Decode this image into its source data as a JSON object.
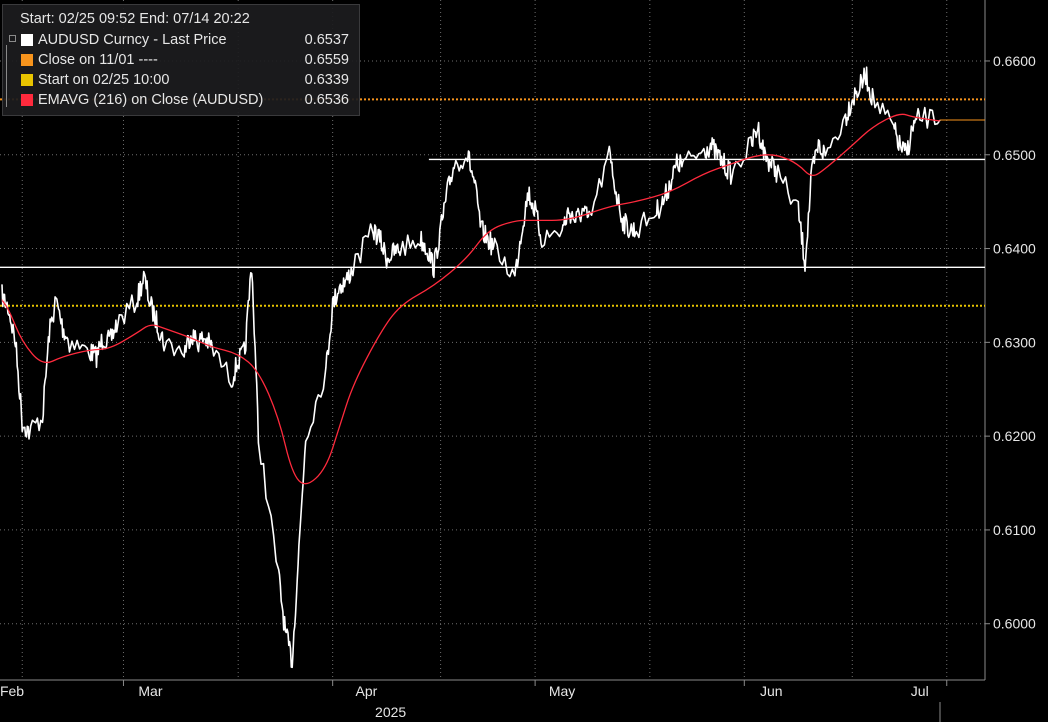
{
  "legend": {
    "header": "Start: 02/25 09:52 End: 07/14 20:22",
    "items": [
      {
        "label": "AUDUSD Curncy - Last Price",
        "value": "0.6537",
        "color": "#ffffff"
      },
      {
        "label": "Close on 11/01 ----",
        "value": "0.6559",
        "color": "#f7941d"
      },
      {
        "label": "Start on 02/25 10:00",
        "value": "0.6339",
        "color": "#e8c400"
      },
      {
        "label": "EMAVG (216)  on Close (AUDUSD)",
        "value": "0.6536",
        "color": "#ff2a3d"
      }
    ]
  },
  "chart_data": {
    "type": "line",
    "x_labels": [
      "Feb",
      "Mar",
      "Apr",
      "May",
      "Jun",
      "Jul"
    ],
    "year_label": "2025",
    "y_ticks": [
      "0.6000",
      "0.6100",
      "0.6200",
      "0.6300",
      "0.6400",
      "0.6500",
      "0.6600"
    ],
    "ylim": [
      0.594,
      0.6665
    ],
    "series": [
      {
        "name": "AUDUSD Curncy - Last Price",
        "color": "#ffffff",
        "points": [
          [
            "02-25",
            0.635
          ],
          [
            "02-26",
            0.6335
          ],
          [
            "02-27",
            0.63
          ],
          [
            "02-28",
            0.6215
          ],
          [
            "03-01",
            0.6205
          ],
          [
            "03-03",
            0.622
          ],
          [
            "03-04",
            0.631
          ],
          [
            "03-05",
            0.6345
          ],
          [
            "03-06",
            0.6315
          ],
          [
            "03-07",
            0.63
          ],
          [
            "03-10",
            0.629
          ],
          [
            "03-11",
            0.6285
          ],
          [
            "03-12",
            0.6305
          ],
          [
            "03-13",
            0.63
          ],
          [
            "03-14",
            0.632
          ],
          [
            "03-17",
            0.6345
          ],
          [
            "03-18",
            0.637
          ],
          [
            "03-19",
            0.634
          ],
          [
            "03-20",
            0.632
          ],
          [
            "03-21",
            0.63
          ],
          [
            "03-24",
            0.629
          ],
          [
            "03-25",
            0.631
          ],
          [
            "03-26",
            0.63
          ],
          [
            "03-27",
            0.6305
          ],
          [
            "03-28",
            0.6295
          ],
          [
            "03-31",
            0.626
          ],
          [
            "04-01",
            0.628
          ],
          [
            "04-02",
            0.629
          ],
          [
            "04-03",
            0.6385
          ],
          [
            "04-04",
            0.62
          ],
          [
            "04-07",
            0.605
          ],
          [
            "04-08",
            0.599
          ],
          [
            "04-09",
            0.596
          ],
          [
            "04-10",
            0.608
          ],
          [
            "04-11",
            0.62
          ],
          [
            "04-14",
            0.627
          ],
          [
            "04-15",
            0.634
          ],
          [
            "04-16",
            0.636
          ],
          [
            "04-17",
            0.6365
          ],
          [
            "04-18",
            0.638
          ],
          [
            "04-21",
            0.642
          ],
          [
            "04-22",
            0.641
          ],
          [
            "04-23",
            0.639
          ],
          [
            "04-24",
            0.6395
          ],
          [
            "04-25",
            0.64
          ],
          [
            "04-28",
            0.641
          ],
          [
            "04-29",
            0.64
          ],
          [
            "04-30",
            0.638
          ],
          [
            "05-01",
            0.642
          ],
          [
            "05-02",
            0.646
          ],
          [
            "05-03",
            0.649
          ],
          [
            "05-05",
            0.65
          ],
          [
            "05-06",
            0.647
          ],
          [
            "05-07",
            0.642
          ],
          [
            "05-08",
            0.641
          ],
          [
            "05-09",
            0.64
          ],
          [
            "05-12",
            0.637
          ],
          [
            "05-13",
            0.642
          ],
          [
            "05-14",
            0.646
          ],
          [
            "05-15",
            0.644
          ],
          [
            "05-16",
            0.641
          ],
          [
            "05-19",
            0.642
          ],
          [
            "05-20",
            0.644
          ],
          [
            "05-21",
            0.643
          ],
          [
            "05-22",
            0.644
          ],
          [
            "05-23",
            0.643
          ],
          [
            "05-26",
            0.65
          ],
          [
            "05-27",
            0.646
          ],
          [
            "05-28",
            0.643
          ],
          [
            "05-29",
            0.642
          ],
          [
            "05-30",
            0.642
          ],
          [
            "06-02",
            0.644
          ],
          [
            "06-03",
            0.645
          ],
          [
            "06-04",
            0.647
          ],
          [
            "06-05",
            0.649
          ],
          [
            "06-06",
            0.649
          ],
          [
            "06-09",
            0.6505
          ],
          [
            "06-10",
            0.651
          ],
          [
            "06-11",
            0.65
          ],
          [
            "06-12",
            0.649
          ],
          [
            "06-13",
            0.648
          ],
          [
            "06-16",
            0.651
          ],
          [
            "06-17",
            0.653
          ],
          [
            "06-18",
            0.65
          ],
          [
            "06-19",
            0.649
          ],
          [
            "06-20",
            0.648
          ],
          [
            "06-23",
            0.644
          ],
          [
            "06-24",
            0.6385
          ],
          [
            "06-25",
            0.648
          ],
          [
            "06-26",
            0.651
          ],
          [
            "06-27",
            0.65
          ],
          [
            "06-30",
            0.654
          ],
          [
            "07-01",
            0.656
          ],
          [
            "07-02",
            0.657
          ],
          [
            "07-03",
            0.6585
          ],
          [
            "07-04",
            0.656
          ],
          [
            "07-07",
            0.653
          ],
          [
            "07-08",
            0.651
          ],
          [
            "07-09",
            0.65
          ],
          [
            "07-10",
            0.653
          ],
          [
            "07-11",
            0.654
          ],
          [
            "07-14",
            0.6537
          ]
        ]
      },
      {
        "name": "EMAVG (216)  on Close (AUDUSD)",
        "color": "#ff2a3d",
        "points": [
          [
            "02-25",
            0.6345
          ],
          [
            "02-26",
            0.6335
          ],
          [
            "02-28",
            0.63
          ],
          [
            "03-03",
            0.6275
          ],
          [
            "03-06",
            0.6285
          ],
          [
            "03-10",
            0.6292
          ],
          [
            "03-13",
            0.6293
          ],
          [
            "03-17",
            0.631
          ],
          [
            "03-19",
            0.632
          ],
          [
            "03-21",
            0.6315
          ],
          [
            "03-25",
            0.6305
          ],
          [
            "03-28",
            0.6295
          ],
          [
            "04-01",
            0.6288
          ],
          [
            "04-04",
            0.627
          ],
          [
            "04-07",
            0.622
          ],
          [
            "04-09",
            0.616
          ],
          [
            "04-11",
            0.6145
          ],
          [
            "04-14",
            0.6165
          ],
          [
            "04-16",
            0.621
          ],
          [
            "04-18",
            0.6255
          ],
          [
            "04-22",
            0.631
          ],
          [
            "04-25",
            0.634
          ],
          [
            "04-30",
            0.636
          ],
          [
            "05-05",
            0.639
          ],
          [
            "05-08",
            0.642
          ],
          [
            "05-12",
            0.643
          ],
          [
            "05-15",
            0.643
          ],
          [
            "05-20",
            0.643
          ],
          [
            "05-26",
            0.6445
          ],
          [
            "05-30",
            0.645
          ],
          [
            "06-04",
            0.646
          ],
          [
            "06-09",
            0.648
          ],
          [
            "06-13",
            0.649
          ],
          [
            "06-17",
            0.65
          ],
          [
            "06-20",
            0.65
          ],
          [
            "06-23",
            0.649
          ],
          [
            "06-25",
            0.6475
          ],
          [
            "06-27",
            0.6485
          ],
          [
            "07-01",
            0.651
          ],
          [
            "07-04",
            0.653
          ],
          [
            "07-08",
            0.6545
          ],
          [
            "07-10",
            0.654
          ],
          [
            "07-14",
            0.6536
          ]
        ]
      }
    ],
    "reference_lines": [
      {
        "value": 0.6559,
        "color": "#f7941d",
        "style": "dotted"
      },
      {
        "value": 0.6339,
        "color": "#e8c400",
        "style": "dotted"
      }
    ],
    "support_lines": [
      {
        "value": 0.638,
        "from": "02-25",
        "to": "07-14"
      },
      {
        "value": 0.6495,
        "from": "04-30",
        "to": "07-14"
      }
    ],
    "grid": true
  }
}
